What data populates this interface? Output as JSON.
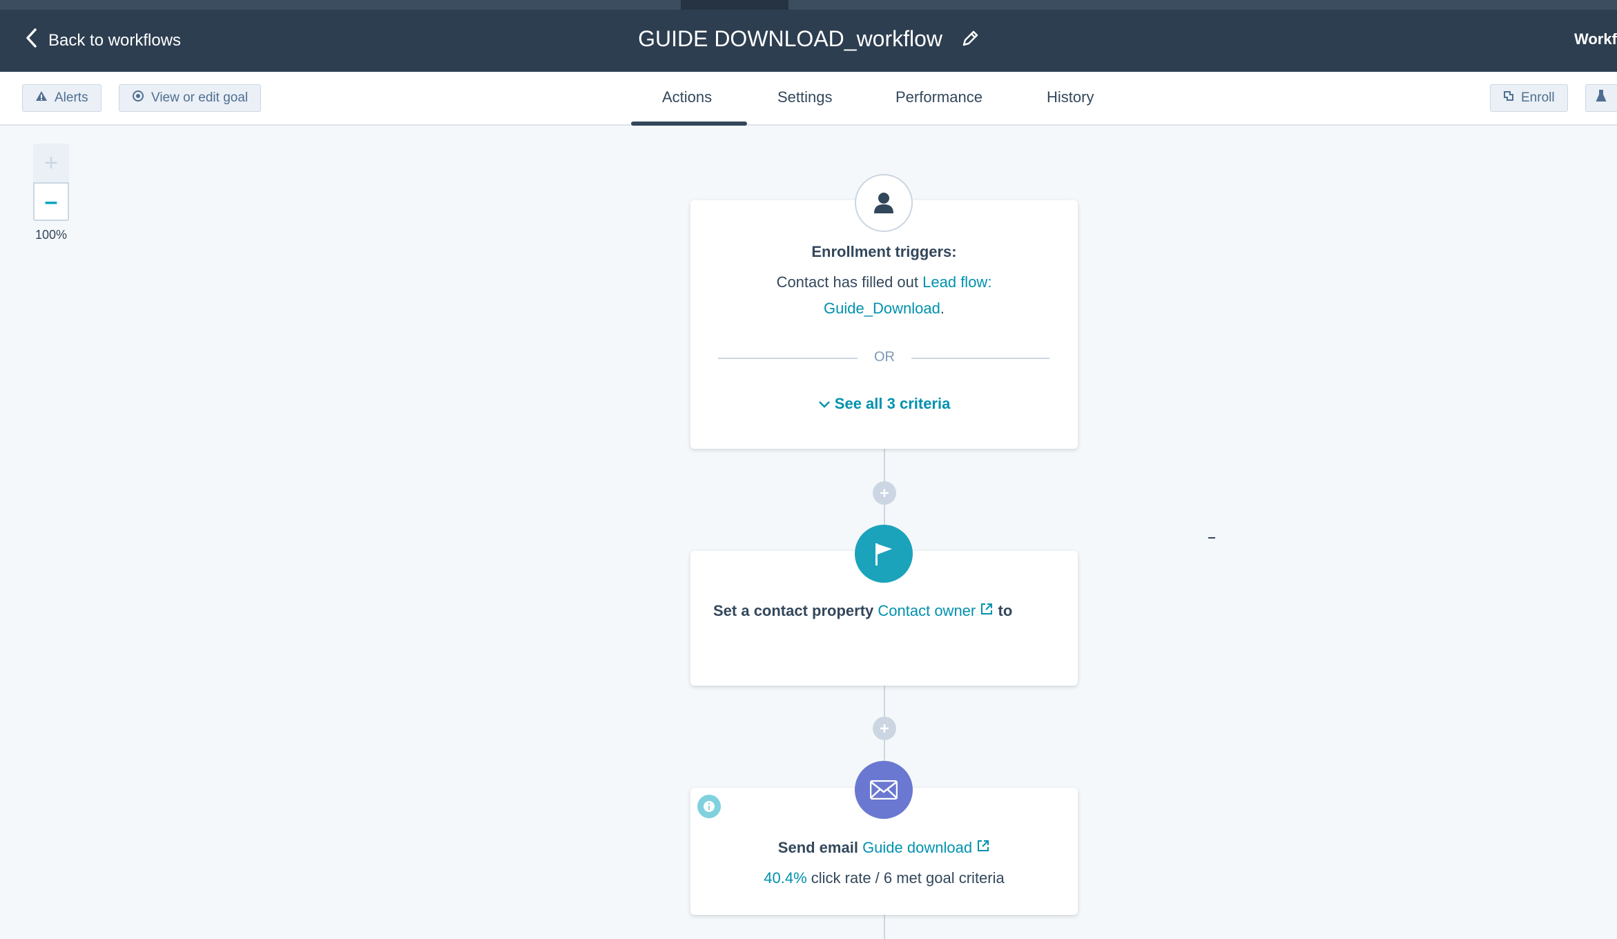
{
  "header": {
    "back_label": "Back to workflows",
    "title": "GUIDE DOWNLOAD_workflow",
    "right_label": "Workflows"
  },
  "toolbar": {
    "alerts_label": "Alerts",
    "goal_label": "View or edit goal",
    "enroll_label": "Enroll"
  },
  "tabs": [
    {
      "label": "Actions",
      "active": true
    },
    {
      "label": "Settings",
      "active": false
    },
    {
      "label": "Performance",
      "active": false
    },
    {
      "label": "History",
      "active": false
    }
  ],
  "zoom": {
    "plus": "+",
    "minus": "–",
    "level": "100%"
  },
  "trigger_card": {
    "heading": "Enrollment triggers:",
    "text_prefix": "Contact has filled out ",
    "link_line1": "Lead flow:",
    "link_line2": "Guide_Download",
    "text_suffix": ".",
    "or_label": "OR",
    "see_all": "See all 3 criteria"
  },
  "action_card_1": {
    "text": "Set a contact property ",
    "link": "Contact owner",
    "suffix": " to"
  },
  "action_card_2": {
    "text": "Send email ",
    "link": "Guide download",
    "stat_value": "40.4%",
    "stat_text": " click rate / 6 met goal criteria"
  },
  "colors": {
    "header_bg": "#2d3e50",
    "accent": "#00a4bd",
    "flag_node": "#1ba3bb",
    "email_node": "#6a78d1",
    "link": "#0091ae"
  },
  "icons": [
    "chevron-left-icon",
    "pencil-icon",
    "warning-icon",
    "goal-icon",
    "enroll-icon",
    "contact-icon",
    "flag-icon",
    "email-icon",
    "info-icon",
    "external-link-icon",
    "chevron-down-icon",
    "plus-icon"
  ]
}
